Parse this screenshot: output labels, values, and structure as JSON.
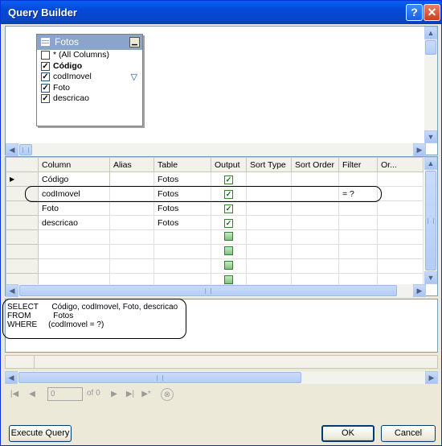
{
  "window": {
    "title": "Query Builder",
    "help": "?",
    "close": "✕"
  },
  "diagram": {
    "table": {
      "name": "Fotos",
      "columns": [
        {
          "label": "* (All Columns)",
          "checked": false,
          "bold": false
        },
        {
          "label": "Código",
          "checked": true,
          "bold": true
        },
        {
          "label": "codImovel",
          "checked": true,
          "bold": false,
          "filtered": true
        },
        {
          "label": "Foto",
          "checked": true,
          "bold": false
        },
        {
          "label": "descricao",
          "checked": true,
          "bold": false
        }
      ]
    }
  },
  "grid": {
    "headers": [
      "Column",
      "Alias",
      "Table",
      "Output",
      "Sort Type",
      "Sort Order",
      "Filter",
      "Or..."
    ],
    "rows": [
      {
        "column": "Código",
        "alias": "",
        "table": "Fotos",
        "output": true,
        "filter": "",
        "current": true
      },
      {
        "column": "codImovel",
        "alias": "",
        "table": "Fotos",
        "output": true,
        "filter": "= ?"
      },
      {
        "column": "Foto",
        "alias": "",
        "table": "Fotos",
        "output": true,
        "filter": ""
      },
      {
        "column": "descricao",
        "alias": "",
        "table": "Fotos",
        "output": true,
        "filter": ""
      }
    ],
    "empty_rows": 4
  },
  "sql": {
    "line1": "SELECT      Código, codImovel, Foto, descricao",
    "line2": "FROM          Fotos",
    "line3": "WHERE     (codImovel = ?)"
  },
  "navigator": {
    "position": "0",
    "of_label": "of 0"
  },
  "buttons": {
    "execute": "Execute Query",
    "ok": "OK",
    "cancel": "Cancel"
  }
}
